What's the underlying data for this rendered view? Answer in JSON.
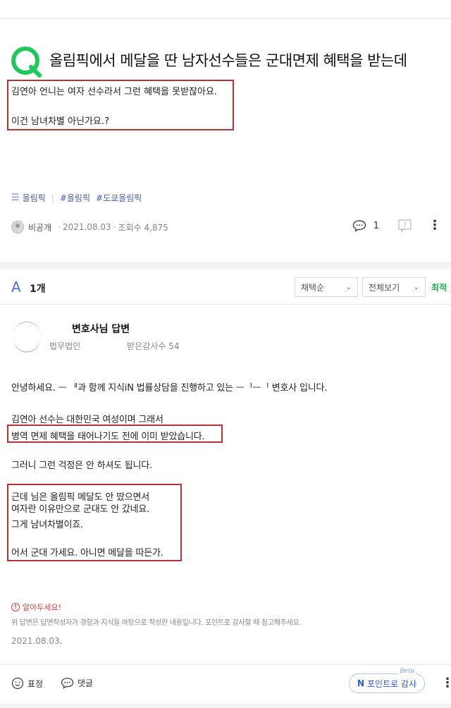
{
  "question": {
    "icon": "q-icon",
    "title": "올림픽에서 메달을 딴 남자선수들은 군대면제 혜택을 받는데",
    "body_lines": [
      "김연아 언니는 여자 선수라서 그런 혜택을 못받잖아요.",
      "이건 남녀차별 아닌가요.?"
    ],
    "tags": [
      "올림픽",
      "#올림픽",
      "#도쿄올림픽"
    ],
    "author": "비공개",
    "date": "2021.08.03",
    "views": "조회수 4,875",
    "comment_count": "1"
  },
  "answers_header": {
    "letter": "A",
    "count": "1개",
    "sort_option": "채택순",
    "filter_option": "전체보기",
    "latest_label": "최적"
  },
  "answer": {
    "author_title": "변호사님 답변",
    "firm": "법무법인",
    "thanks": "받은감사수 54",
    "lines": [
      "안녕하세요. ᅳ ᅵᅵ과 함께 지식iN 법률상담을 진행하고 있는 ᅳᅵᅳᅵ 변호사 입니다.",
      "김연아 선수는 대한민국 여성이며 그래서",
      "병역 면제 혜택을 태어나기도 전에 이미 받았습니다.",
      "그러니 그런 걱정은 안 하셔도 됩니다.",
      "근데 님은 올림픽 메달도 안 땄으면서",
      "여자란 이유만으로 군대도 안 갔네요.",
      "그게 남녀차별이죠.",
      "어서 군대 가세요. 아니면 메달을 따든가."
    ],
    "notice_title": "알아두세요!",
    "notice_text": "위 답변은 답변작성자가 경험과 지식을 바탕으로 작성한 내용입니다. 포인트로 감사할 때 참고해주세요.",
    "date": "2021.08.03."
  },
  "bottom_bar": {
    "emotion_label": "표정",
    "comment_label": "댓글",
    "point_label": "포인트로 감사",
    "point_prefix": "N",
    "beta_label": "Beta"
  },
  "colors": {
    "q_green": "#1ec85a",
    "highlight_red": "#b6303a",
    "answer_blue": "#4d6bd8",
    "latest_green": "#1bb44a"
  }
}
